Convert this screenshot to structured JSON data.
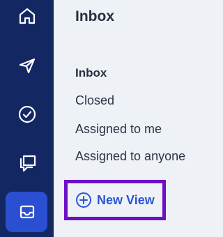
{
  "sidebar": {
    "items": [
      {
        "name": "home",
        "icon": "home-icon"
      },
      {
        "name": "send",
        "icon": "send-icon"
      },
      {
        "name": "tasks",
        "icon": "check-circle-icon"
      },
      {
        "name": "chats",
        "icon": "chat-bubbles-icon"
      },
      {
        "name": "inbox",
        "icon": "inbox-tray-icon",
        "active": true
      }
    ],
    "active_color": "#2a4fd0",
    "background_color": "#132863"
  },
  "panel": {
    "title": "Inbox",
    "nav_items": [
      {
        "label": "Inbox",
        "current": true
      },
      {
        "label": "Closed"
      },
      {
        "label": "Assigned to me"
      },
      {
        "label": "Assigned to anyone"
      }
    ],
    "new_view": {
      "label": "New View",
      "icon": "plus-circle-icon",
      "highlight_color": "#6d10c8",
      "accent_color": "#2a55d6"
    }
  }
}
